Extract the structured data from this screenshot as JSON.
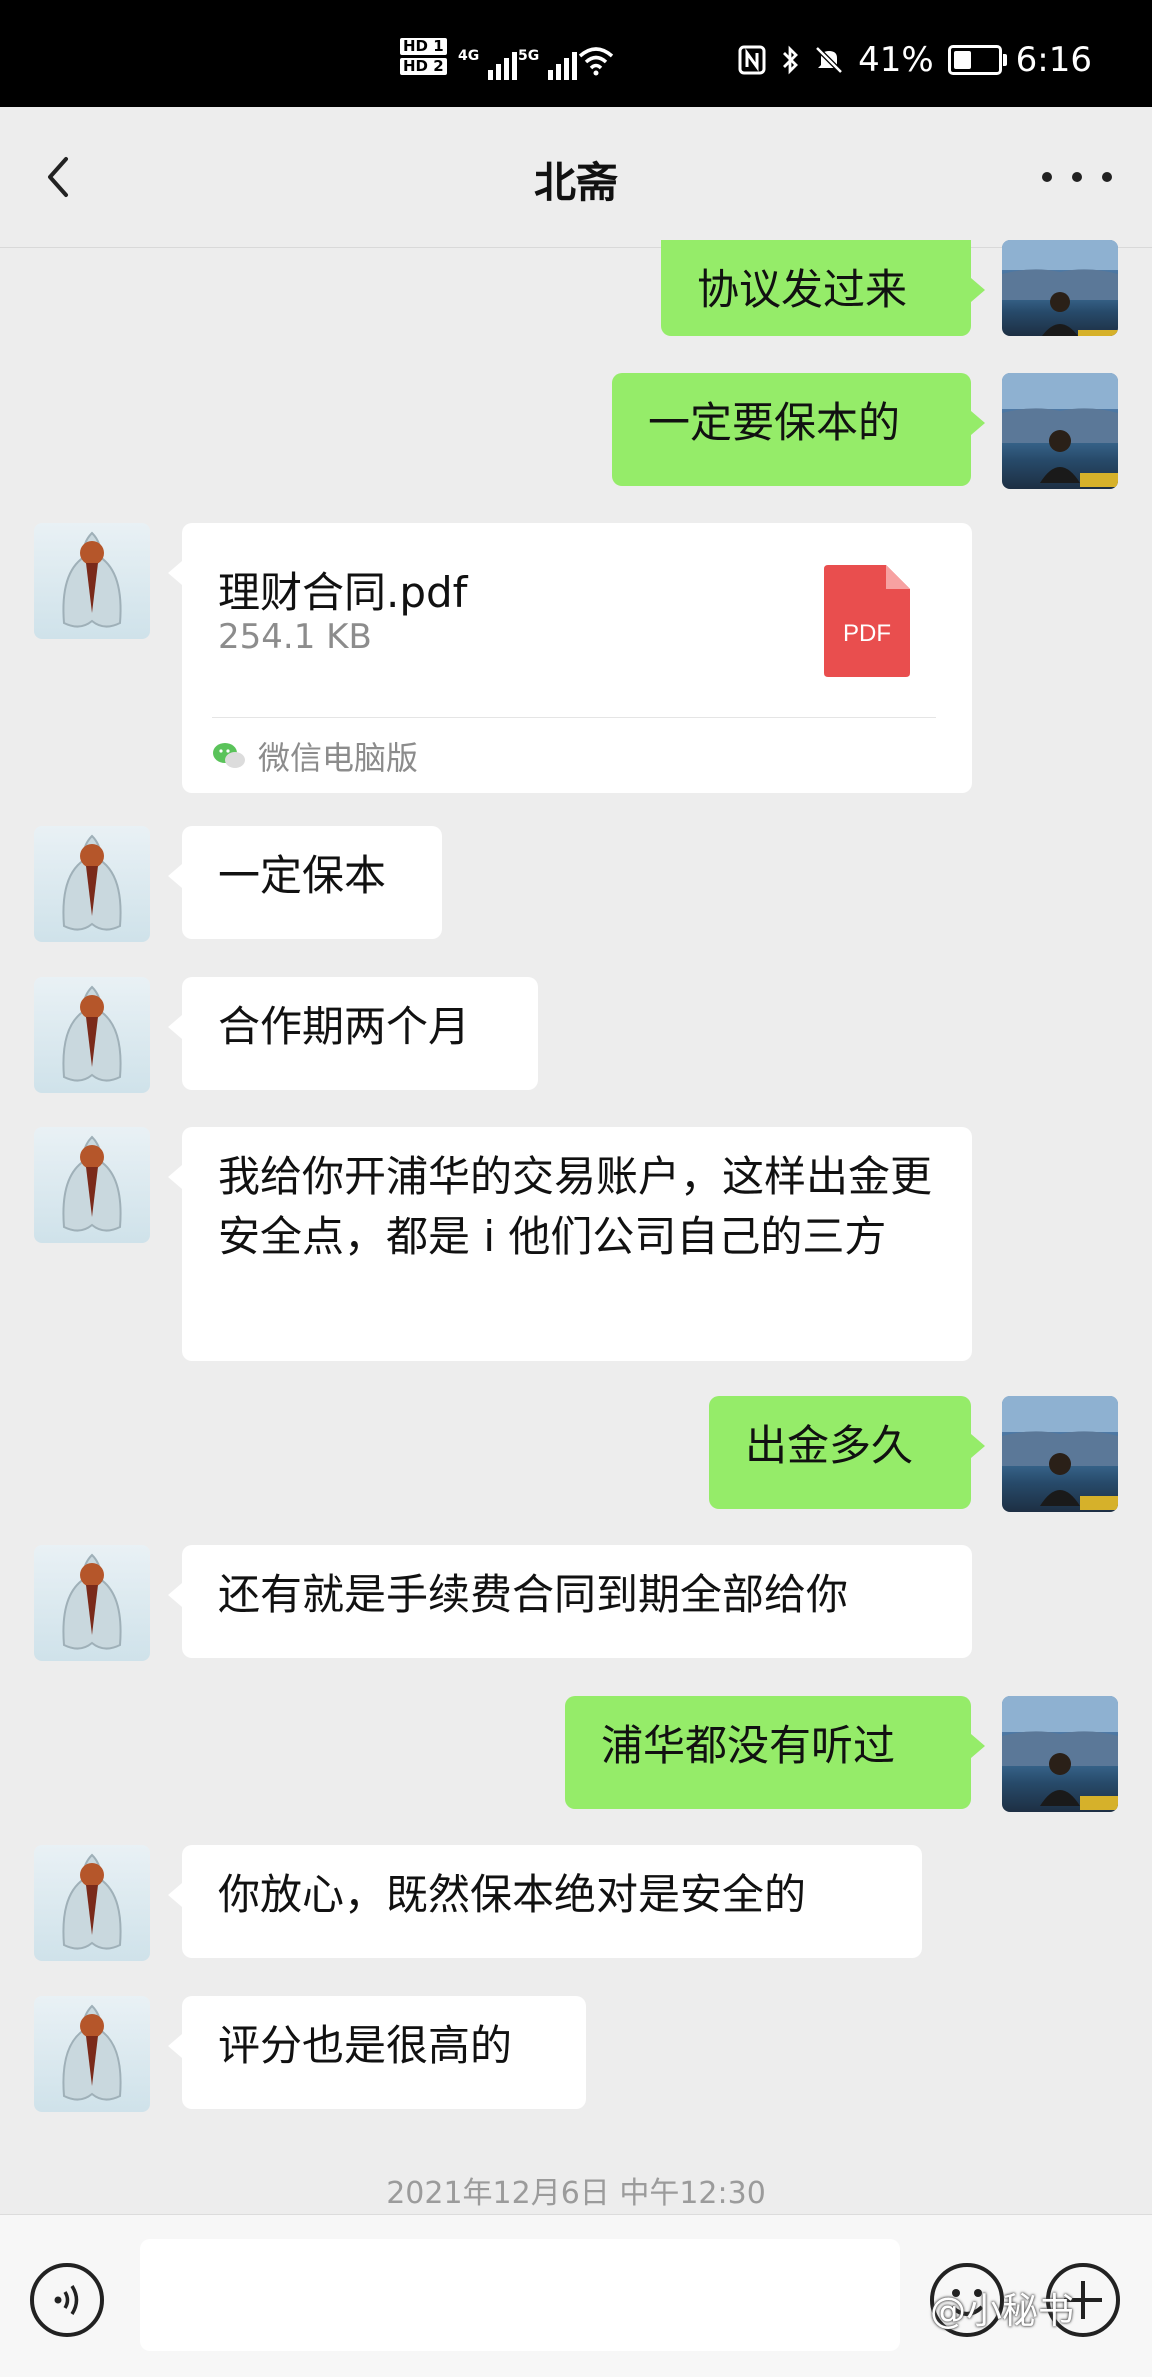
{
  "status_bar": {
    "sim_labels": [
      "HD 1",
      "HD 2"
    ],
    "network": [
      "4G",
      "5G"
    ],
    "battery": "41%",
    "battery_level": 0.41,
    "time": "6:16"
  },
  "header": {
    "title": "北斋"
  },
  "messages": [
    {
      "side": "self",
      "text": "协议发过来"
    },
    {
      "side": "self",
      "text": "一定要保本的"
    },
    {
      "side": "other",
      "type": "file",
      "file_name": "理财合同.pdf",
      "file_size": "254.1 KB",
      "file_icon_label": "PDF",
      "source": "微信电脑版"
    },
    {
      "side": "other",
      "text": "一定保本"
    },
    {
      "side": "other",
      "text": "合作期两个月"
    },
    {
      "side": "other",
      "text": "我给你开浦华的交易账户，这样出金更安全点，都是 i 他们公司自己的三方"
    },
    {
      "side": "self",
      "text": "出金多久"
    },
    {
      "side": "other",
      "text": "还有就是手续费合同到期全部给你"
    },
    {
      "side": "self",
      "text": "浦华都没有听过"
    },
    {
      "side": "other",
      "text": "你放心，既然保本绝对是安全的"
    },
    {
      "side": "other",
      "text": "评分也是很高的"
    }
  ],
  "timestamp": "2021年12月6日 中午12:30",
  "input_bar": {
    "icons": [
      "voice-icon",
      "emoji-icon",
      "plus-icon"
    ]
  },
  "watermark": "@小秘书",
  "colors": {
    "self_bubble": "#95ec69",
    "other_bubble": "#ffffff",
    "background": "#ededed",
    "pdf_icon": "#e94e4e"
  }
}
